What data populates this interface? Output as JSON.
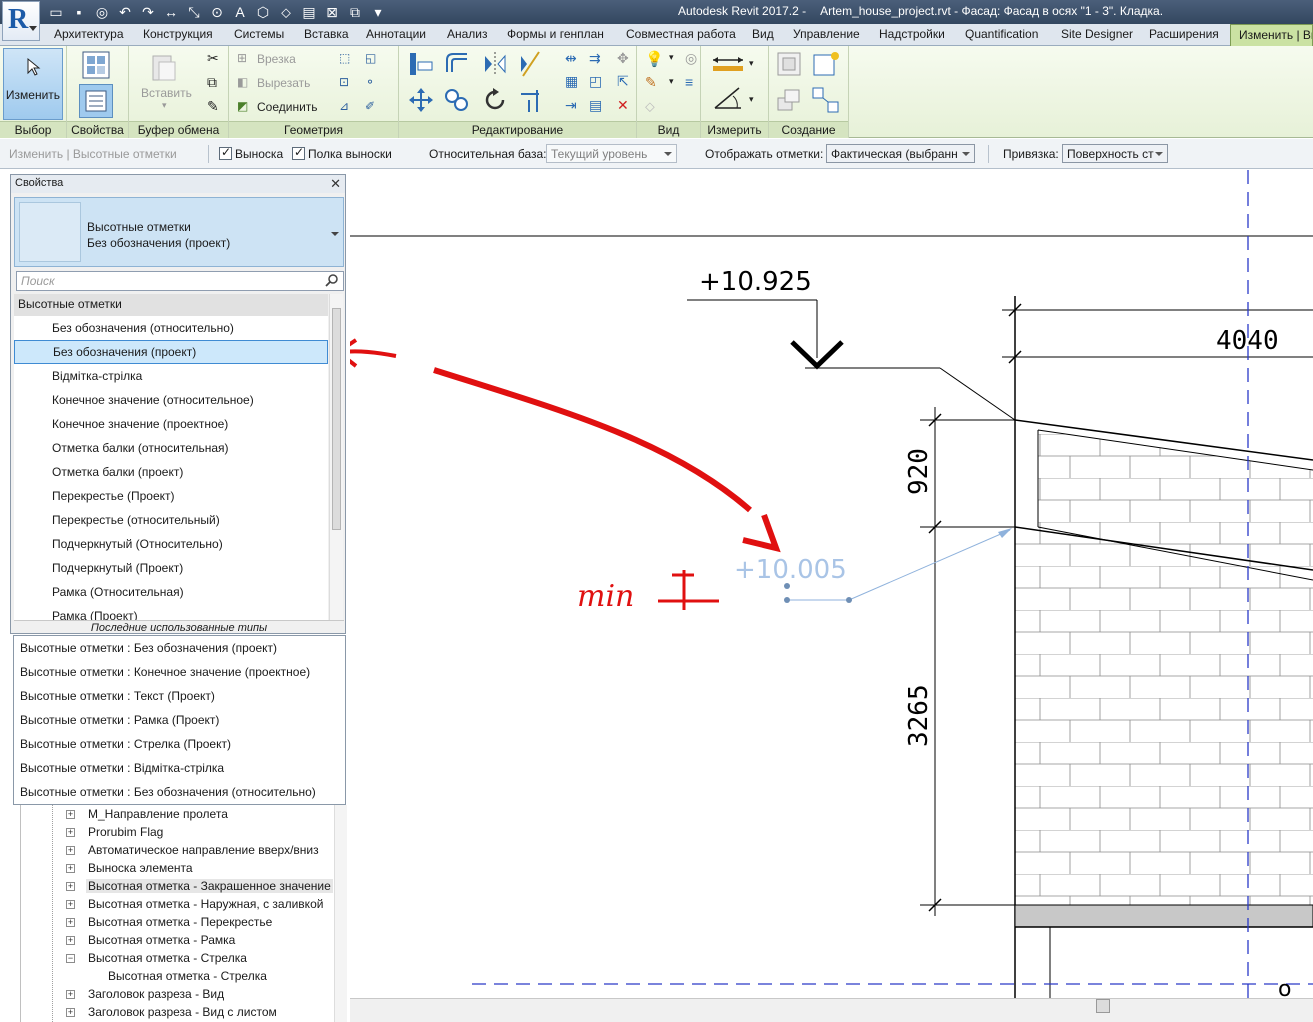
{
  "title_bar": {
    "app": "Autodesk Revit 2017.2 -",
    "document": "Artem_house_project.rvt - Фасад: Фасад  в осях \"1 - 3\". Кладка."
  },
  "ribbon_tabs": [
    "Архитектура",
    "Конструкция",
    "Системы",
    "Вставка",
    "Аннотации",
    "Анализ",
    "Формы и генплан",
    "Совместная работа",
    "Вид",
    "Управление",
    "Надстройки",
    "Quantification",
    "Site Designer",
    "Расширения",
    "Изменить | Вы"
  ],
  "ribbon": {
    "select_panel": {
      "modify_label": "Изменить",
      "title": "Выбор"
    },
    "properties_panel": {
      "title": "Свойства"
    },
    "clipboard_panel": {
      "paste_label": "Вставить",
      "title": "Буфер обмена"
    },
    "geometry_panel": {
      "cope_label": "Врезка",
      "cut_label": "Вырезать",
      "join_label": "Соединить",
      "title": "Геометрия"
    },
    "modify_panel": {
      "title": "Редактирование"
    },
    "view_panel": {
      "title": "Вид"
    },
    "measure_panel": {
      "title": "Измерить"
    },
    "create_panel": {
      "title": "Создание"
    }
  },
  "options_bar": {
    "context_label": "Изменить | Высотные отметки",
    "leader_checkbox": {
      "label": "Выноска",
      "checked": true
    },
    "shoulder_checkbox": {
      "label": "Полка выноски",
      "checked": true
    },
    "relative_base_label": "Относительная база:",
    "relative_base_value": "Текущий уровень",
    "display_label": "Отображать отметки:",
    "display_value": "Фактическая (выбранн",
    "snap_label": "Привязка:",
    "snap_value": "Поверхность ст"
  },
  "properties_palette": {
    "title": "Свойства",
    "family": "Высотные отметки",
    "type": "Без обозначения (проект)",
    "search_placeholder": "Поиск",
    "group_header": "Высотные отметки",
    "types": [
      "Без обозначения (относительно)",
      "Без обозначения (проект)",
      "Відмітка-стрілка",
      "Конечное значение (относительное)",
      "Конечное значение (проектное)",
      "Отметка балки (относительная)",
      "Отметка балки (проект)",
      "Перекрестье (Проект)",
      "Перекрестье (относительный)",
      "Подчеркнутый (Относительно)",
      "Подчеркнутый (Проект)",
      "Рамка (Относительная)",
      "Рамка (Проект)"
    ],
    "selected_index": 1,
    "recent_header": "Последние использованные типы"
  },
  "recent_types": [
    "Высотные отметки : Без обозначения (проект)",
    "Высотные отметки : Конечное значение (проектное)",
    "Высотные отметки : Текст (Проект)",
    "Высотные отметки : Рамка (Проект)",
    "Высотные отметки : Стрелка (Проект)",
    "Высотные отметки : Відмітка-стрілка",
    "Высотные отметки : Без обозначения (относительно)"
  ],
  "project_browser": [
    {
      "label": "M_Направление пролета",
      "toggle": "+"
    },
    {
      "label": "Prorubim Flag",
      "toggle": "+"
    },
    {
      "label": "Автоматическое направление вверх/вниз",
      "toggle": "+"
    },
    {
      "label": "Выноска элемента",
      "toggle": "+"
    },
    {
      "label": "Высотная отметка - Закрашенное значение",
      "toggle": "+",
      "highlight": true
    },
    {
      "label": "Высотная отметка - Наружная, с заливкой",
      "toggle": "+"
    },
    {
      "label": "Высотная отметка - Перекрестье",
      "toggle": "+"
    },
    {
      "label": "Высотная отметка - Рамка",
      "toggle": "+"
    },
    {
      "label": "Высотная отметка - Стрелка",
      "toggle": "−"
    },
    {
      "label": "Высотная отметка - Стрелка",
      "child": true
    },
    {
      "label": "Заголовок разреза - Вид",
      "toggle": "+"
    },
    {
      "label": "Заголовок разреза - Вид с листом",
      "toggle": "+"
    }
  ],
  "drawing": {
    "level_mark": "+10.925",
    "placing_mark": "+10.005",
    "dim_top": "4040",
    "dim_920": "920",
    "dim_3265": "3265",
    "handwritten_note": "min"
  },
  "colors": {
    "annotation_red": "#e01010",
    "ribbon_active_tab": "#cbe2a3",
    "selection_blue": "#3f8bd3",
    "placing_mark": "#a9c4e6"
  }
}
